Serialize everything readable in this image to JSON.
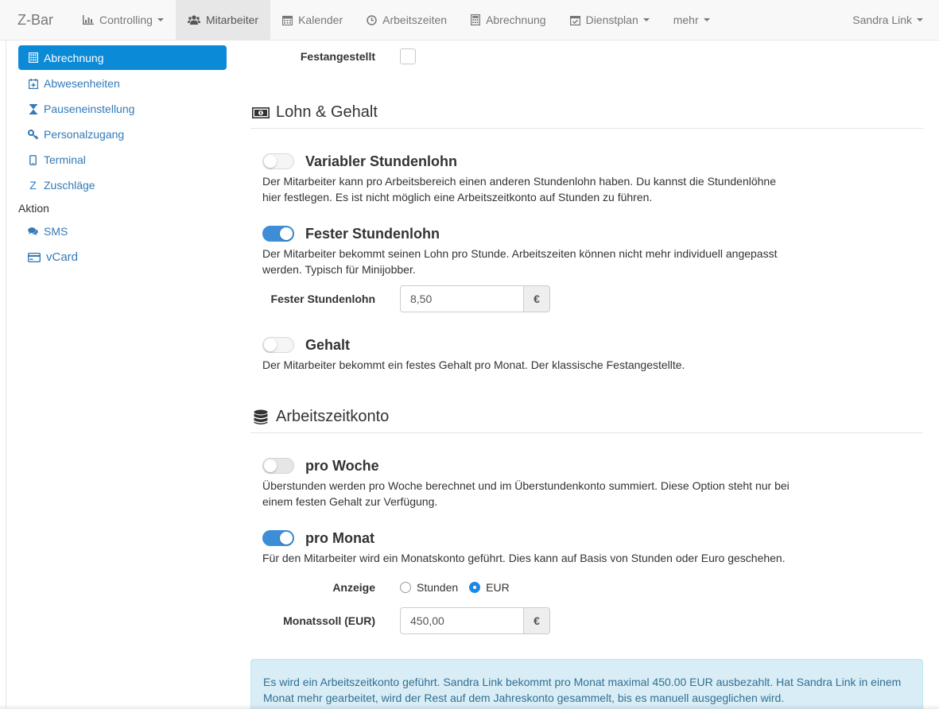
{
  "navbar": {
    "brand": "Z-Bar",
    "items": [
      {
        "label": "Controlling",
        "icon": "bar-chart-icon",
        "dropdown": true
      },
      {
        "label": "Mitarbeiter",
        "icon": "users-icon",
        "active": true
      },
      {
        "label": "Kalender",
        "icon": "calendar-icon"
      },
      {
        "label": "Arbeitszeiten",
        "icon": "clock-icon"
      },
      {
        "label": "Abrechnung",
        "icon": "calculator-icon"
      },
      {
        "label": "Dienstplan",
        "icon": "calendar-check-icon",
        "dropdown": true
      },
      {
        "label": "mehr",
        "dropdown": true
      }
    ],
    "user": "Sandra Link"
  },
  "sidebar": {
    "items": [
      {
        "label": "Abrechnung",
        "icon": "calculator-icon",
        "active": true
      },
      {
        "label": "Abwesenheiten",
        "icon": "calendar-plus-icon"
      },
      {
        "label": "Pauseneinstellung",
        "icon": "hourglass-icon"
      },
      {
        "label": "Personalzugang",
        "icon": "key-icon"
      },
      {
        "label": "Terminal",
        "icon": "tablet-icon"
      },
      {
        "label": "Zuschläge",
        "icon": "z-icon"
      }
    ],
    "section_aktion": "Aktion",
    "action_items": [
      {
        "label": "SMS",
        "icon": "comments-icon"
      },
      {
        "label": "vCard",
        "icon": "credit-card-icon"
      }
    ]
  },
  "main": {
    "festangestellt_label": "Festangestellt",
    "festangestellt_checked": false,
    "lohn_section_title": "Lohn & Gehalt",
    "variabler": {
      "title": "Variabler Stundenlohn",
      "enabled": false,
      "desc": "Der Mitarbeiter kann pro Arbeitsbereich einen anderen Stundenlohn haben. Du kannst die Stundenlöhne hier festlegen. Es ist nicht möglich eine Arbeitszeitkonto auf Stunden zu führen."
    },
    "fester": {
      "title": "Fester Stundenlohn",
      "enabled": true,
      "desc": "Der Mitarbeiter bekommt seinen Lohn pro Stunde. Arbeitszeiten können nicht mehr individuell angepasst werden. Typisch für Minijobber.",
      "field_label": "Fester Stundenlohn",
      "field_value": "8,50",
      "currency": "€"
    },
    "gehalt": {
      "title": "Gehalt",
      "enabled": false,
      "desc": "Der Mitarbeiter bekommt ein festes Gehalt pro Monat. Der klassische Festangestellte."
    },
    "konto_section_title": "Arbeitszeitkonto",
    "woche": {
      "title": "pro Woche",
      "enabled": false,
      "desc": "Überstunden werden pro Woche berechnet und im Überstundenkonto summiert. Diese Option steht nur bei einem festen Gehalt zur Verfügung."
    },
    "monat": {
      "title": "pro Monat",
      "enabled": true,
      "desc": "Für den Mitarbeiter wird ein Monatskonto geführt. Dies kann auf Basis von Stunden oder Euro geschehen."
    },
    "anzeige_label": "Anzeige",
    "anzeige_options": [
      "Stunden",
      "EUR"
    ],
    "anzeige_selected": "EUR",
    "monatssoll_label": "Monatssoll (EUR)",
    "monatssoll_value": "450,00",
    "monatssoll_currency": "€",
    "info_text": "Es wird ein Arbeitszeitkonto geführt. Sandra Link bekommt pro Monat maximal 450.00 EUR ausbezahlt. Hat Sandra Link in einem Monat mehr gearbeitet, wird der Rest auf dem Jahreskonto gesammelt, bis es manuell ausgeglichen wird."
  },
  "colors": {
    "accent": "#0b8ad7",
    "toggle_on": "#3d8ed7",
    "link": "#337ab7",
    "info_bg": "#d9edf7",
    "info_text": "#31708f"
  }
}
